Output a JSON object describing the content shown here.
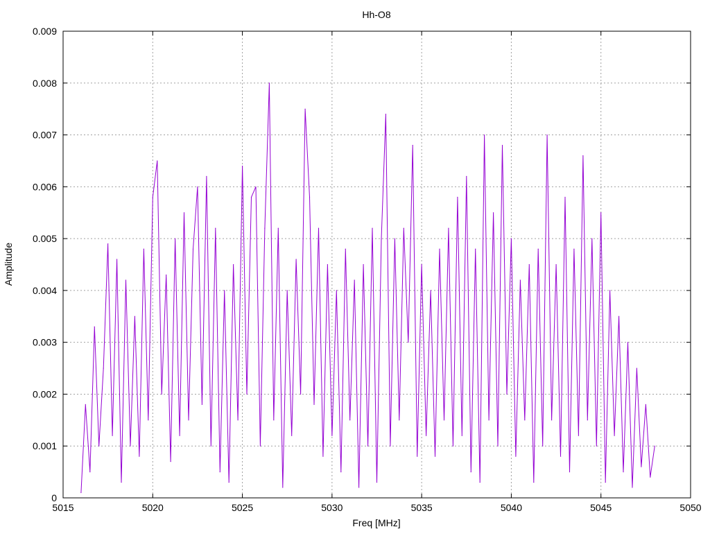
{
  "chart_data": {
    "type": "line",
    "title": "Hh-O8",
    "xlabel": "Freq [MHz]",
    "ylabel": "Amplitude",
    "xlim": [
      5015,
      5050
    ],
    "ylim": [
      0,
      0.009
    ],
    "grid": true,
    "x_start": 5016,
    "x_step": 0.25,
    "xticks": [
      "5015",
      "5020",
      "5025",
      "5030",
      "5035",
      "5040",
      "5045",
      "5050"
    ],
    "yticks": [
      "0",
      "0.001",
      "0.002",
      "0.003",
      "0.004",
      "0.005",
      "0.006",
      "0.007",
      "0.008",
      "0.009"
    ],
    "series": [
      {
        "name": "Hh-O8",
        "color": "#9400d3",
        "values": [
          0.0001,
          0.0018,
          0.0005,
          0.0033,
          0.001,
          0.0025,
          0.0049,
          0.0012,
          0.0046,
          0.0003,
          0.0042,
          0.001,
          0.0035,
          0.0008,
          0.0048,
          0.0015,
          0.0058,
          0.0065,
          0.002,
          0.0043,
          0.0007,
          0.005,
          0.0012,
          0.0055,
          0.0015,
          0.0048,
          0.006,
          0.0018,
          0.0062,
          0.001,
          0.0052,
          0.0005,
          0.004,
          0.0003,
          0.0045,
          0.0015,
          0.0064,
          0.002,
          0.0058,
          0.006,
          0.001,
          0.0052,
          0.008,
          0.0015,
          0.0052,
          0.0002,
          0.004,
          0.0012,
          0.0046,
          0.002,
          0.0075,
          0.0058,
          0.0018,
          0.0052,
          0.0008,
          0.0045,
          0.0012,
          0.004,
          0.0005,
          0.0048,
          0.0015,
          0.0042,
          0.0002,
          0.0045,
          0.001,
          0.0052,
          0.0003,
          0.005,
          0.0074,
          0.001,
          0.005,
          0.0015,
          0.0052,
          0.003,
          0.0068,
          0.0008,
          0.0045,
          0.0012,
          0.004,
          0.0008,
          0.0048,
          0.0015,
          0.0052,
          0.001,
          0.0058,
          0.0012,
          0.0062,
          0.0005,
          0.0048,
          0.0003,
          0.007,
          0.0015,
          0.0055,
          0.001,
          0.0068,
          0.002,
          0.005,
          0.0008,
          0.0042,
          0.0015,
          0.0045,
          0.0003,
          0.0048,
          0.001,
          0.007,
          0.0015,
          0.0045,
          0.0008,
          0.0058,
          0.0005,
          0.0048,
          0.0012,
          0.0066,
          0.0015,
          0.005,
          0.001,
          0.0055,
          0.0003,
          0.004,
          0.0012,
          0.0035,
          0.0005,
          0.003,
          0.0002,
          0.0025,
          0.0006,
          0.0018,
          0.0004,
          0.001
        ]
      }
    ]
  }
}
